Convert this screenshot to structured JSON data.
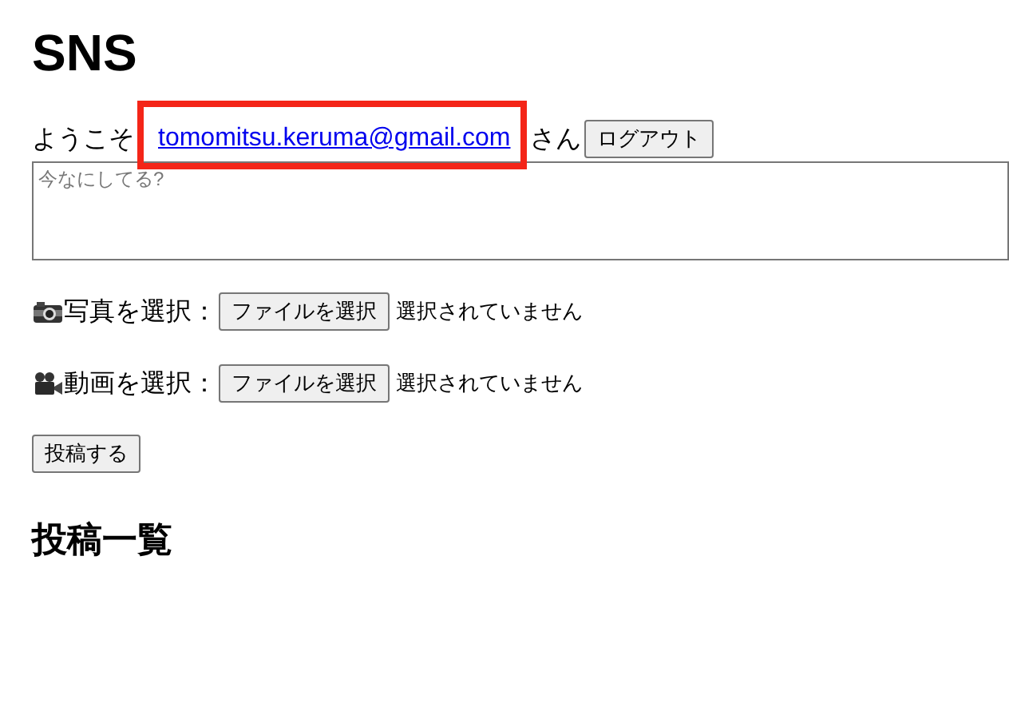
{
  "title": "SNS",
  "welcome": {
    "prefix": "ようこそ",
    "email": "tomomitsu.keruma@gmail.com",
    "suffix": "さん",
    "logout_button": "ログアウト",
    "highlighted": true
  },
  "post_form": {
    "placeholder": "今なにしてる?",
    "file_inputs": [
      {
        "kind": "photo",
        "label": "写真を選択：",
        "button": "ファイルを選択",
        "status": "選択されていません"
      },
      {
        "kind": "video",
        "label": "動画を選択：",
        "button": "ファイルを選択",
        "status": "選択されていません"
      }
    ],
    "submit_button": "投稿する"
  },
  "posts_heading": "投稿一覧"
}
